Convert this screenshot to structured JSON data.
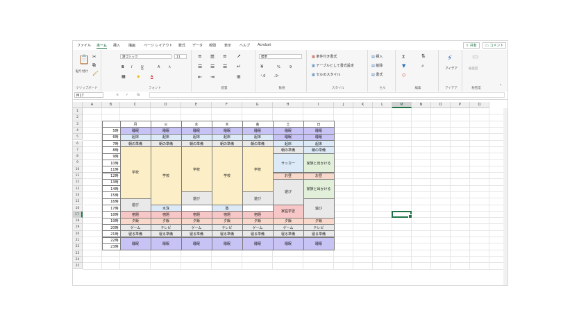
{
  "ribbon": {
    "tabs": [
      "ファイル",
      "ホーム",
      "挿入",
      "描画",
      "ページ レイアウト",
      "数式",
      "データ",
      "校閲",
      "表示",
      "ヘルプ",
      "Acrobat"
    ],
    "active_tab": "ホーム",
    "share_label": "共有",
    "comment_label": "コメント",
    "clipboard": {
      "paste": "貼り付け",
      "label": "クリップボード"
    },
    "font": {
      "name": "游ゴシック",
      "size": "11",
      "bold": "B",
      "italic": "I",
      "underline": "U",
      "grow": "A",
      "shrink": "A",
      "color_a": "A",
      "label": "フォント"
    },
    "alignment": {
      "label": "配置"
    },
    "number": {
      "format": "標準",
      "percent": "%",
      "comma": "9",
      "label": "数値"
    },
    "styles": {
      "conditional": "条件付き書式",
      "table": "テーブルとして書式設定",
      "cell": "セルのスタイル",
      "label": "スタイル"
    },
    "cells": {
      "insert": "挿入",
      "delete": "削除",
      "format": "書式",
      "label": "セル"
    },
    "editing": {
      "sigma": "Σ",
      "label": "編集"
    },
    "ideas": {
      "button": "アイデア",
      "label": "アイデア"
    },
    "sensitivity": {
      "button": "秘密度",
      "label": "秘密度"
    }
  },
  "formula_bar": {
    "name_box": "M17",
    "fx": "fx",
    "cancel": "×",
    "enter": "✓",
    "value": ""
  },
  "columns": [
    "A",
    "B",
    "C",
    "D",
    "E",
    "F",
    "G",
    "H",
    "I",
    "J",
    "K",
    "L",
    "M",
    "N",
    "O",
    "P",
    "Q"
  ],
  "selected_cell": {
    "col": "M",
    "row": "17"
  },
  "rows": [
    "1",
    "2",
    "3",
    "4",
    "5",
    "6",
    "7",
    "8",
    "9",
    "10",
    "11",
    "12",
    "13",
    "14",
    "15",
    "16",
    "17",
    "18",
    "19",
    "20",
    "21",
    "22",
    "23",
    "24",
    "25"
  ],
  "timetable": {
    "days": [
      "月",
      "火",
      "水",
      "木",
      "金",
      "土",
      "日"
    ],
    "hours": [
      "5時",
      "6時",
      "7時",
      "8時",
      "9時",
      "10時",
      "11時",
      "12時",
      "13時",
      "14時",
      "15時",
      "16時",
      "17時",
      "18時",
      "19時",
      "20時",
      "21時",
      "22時",
      "23時"
    ],
    "blocks": [
      {
        "col": 0,
        "r0": 0,
        "r1": 0,
        "text": "睡眠",
        "color": "#c8c3f5"
      },
      {
        "col": 0,
        "r0": 1,
        "r1": 1,
        "text": "起床",
        "color": "#dce9f7"
      },
      {
        "col": 0,
        "r0": 2,
        "r1": 2,
        "text": "朝の準備",
        "color": "#e9e9e9"
      },
      {
        "col": 0,
        "r0": 3,
        "r1": 10,
        "text": "学校",
        "color": "#fcefc7"
      },
      {
        "col": 0,
        "r0": 11,
        "r1": 12,
        "text": "遊び",
        "color": "#e9e9e9"
      },
      {
        "col": 0,
        "r0": 13,
        "r1": 13,
        "text": "宿題",
        "color": "#f7c6c6"
      },
      {
        "col": 0,
        "r0": 14,
        "r1": 14,
        "text": "夕飯",
        "color": "#f9d8cc"
      },
      {
        "col": 0,
        "r0": 15,
        "r1": 15,
        "text": "ゲーム",
        "color": "#e9e9e9"
      },
      {
        "col": 0,
        "r0": 16,
        "r1": 16,
        "text": "寝る準備",
        "color": "#e9e9e9"
      },
      {
        "col": 0,
        "r0": 17,
        "r1": 18,
        "text": "睡眠",
        "color": "#c8c3f5"
      },
      {
        "col": 1,
        "r0": 0,
        "r1": 0,
        "text": "睡眠",
        "color": "#c8c3f5"
      },
      {
        "col": 1,
        "r0": 1,
        "r1": 1,
        "text": "起床",
        "color": "#dce9f7"
      },
      {
        "col": 1,
        "r0": 2,
        "r1": 2,
        "text": "朝の準備",
        "color": "#e9e9e9"
      },
      {
        "col": 1,
        "r0": 3,
        "r1": 11,
        "text": "学校",
        "color": "#fcefc7"
      },
      {
        "col": 1,
        "r0": 12,
        "r1": 12,
        "text": "水泳",
        "color": "#dce9f7"
      },
      {
        "col": 1,
        "r0": 13,
        "r1": 13,
        "text": "宿題",
        "color": "#f7c6c6"
      },
      {
        "col": 1,
        "r0": 14,
        "r1": 14,
        "text": "夕飯",
        "color": "#f9d8cc"
      },
      {
        "col": 1,
        "r0": 15,
        "r1": 15,
        "text": "テレビ",
        "color": "#e9e9e9"
      },
      {
        "col": 1,
        "r0": 16,
        "r1": 16,
        "text": "寝る準備",
        "color": "#e9e9e9"
      },
      {
        "col": 1,
        "r0": 17,
        "r1": 18,
        "text": "睡眠",
        "color": "#c8c3f5"
      },
      {
        "col": 2,
        "r0": 0,
        "r1": 0,
        "text": "睡眠",
        "color": "#c8c3f5"
      },
      {
        "col": 2,
        "r0": 1,
        "r1": 1,
        "text": "起床",
        "color": "#dce9f7"
      },
      {
        "col": 2,
        "r0": 2,
        "r1": 2,
        "text": "朝の準備",
        "color": "#e9e9e9"
      },
      {
        "col": 2,
        "r0": 3,
        "r1": 9,
        "text": "学校",
        "color": "#fcefc7"
      },
      {
        "col": 2,
        "r0": 10,
        "r1": 11,
        "text": "遊び",
        "color": "#e9e9e9"
      },
      {
        "col": 2,
        "r0": 12,
        "r1": 12,
        "text": "",
        "color": "#ffffff"
      },
      {
        "col": 2,
        "r0": 13,
        "r1": 13,
        "text": "宿題",
        "color": "#f7c6c6"
      },
      {
        "col": 2,
        "r0": 14,
        "r1": 14,
        "text": "夕飯",
        "color": "#f9d8cc"
      },
      {
        "col": 2,
        "r0": 15,
        "r1": 15,
        "text": "ゲーム",
        "color": "#e9e9e9"
      },
      {
        "col": 2,
        "r0": 16,
        "r1": 16,
        "text": "寝る準備",
        "color": "#e9e9e9"
      },
      {
        "col": 2,
        "r0": 17,
        "r1": 18,
        "text": "睡眠",
        "color": "#c8c3f5"
      },
      {
        "col": 3,
        "r0": 0,
        "r1": 0,
        "text": "睡眠",
        "color": "#c8c3f5"
      },
      {
        "col": 3,
        "r0": 1,
        "r1": 1,
        "text": "起床",
        "color": "#dce9f7"
      },
      {
        "col": 3,
        "r0": 2,
        "r1": 2,
        "text": "朝の準備",
        "color": "#e9e9e9"
      },
      {
        "col": 3,
        "r0": 3,
        "r1": 11,
        "text": "学校",
        "color": "#fcefc7"
      },
      {
        "col": 3,
        "r0": 12,
        "r1": 12,
        "text": "塾",
        "color": "#dce9f7"
      },
      {
        "col": 3,
        "r0": 13,
        "r1": 13,
        "text": "宿題",
        "color": "#f7c6c6"
      },
      {
        "col": 3,
        "r0": 14,
        "r1": 14,
        "text": "夕飯",
        "color": "#f9d8cc"
      },
      {
        "col": 3,
        "r0": 15,
        "r1": 15,
        "text": "テレビ",
        "color": "#e9e9e9"
      },
      {
        "col": 3,
        "r0": 16,
        "r1": 16,
        "text": "寝る準備",
        "color": "#e9e9e9"
      },
      {
        "col": 3,
        "r0": 17,
        "r1": 18,
        "text": "睡眠",
        "color": "#c8c3f5"
      },
      {
        "col": 4,
        "r0": 0,
        "r1": 0,
        "text": "睡眠",
        "color": "#c8c3f5"
      },
      {
        "col": 4,
        "r0": 1,
        "r1": 1,
        "text": "起床",
        "color": "#dce9f7"
      },
      {
        "col": 4,
        "r0": 2,
        "r1": 2,
        "text": "朝の準備",
        "color": "#e9e9e9"
      },
      {
        "col": 4,
        "r0": 3,
        "r1": 9,
        "text": "学校",
        "color": "#fcefc7"
      },
      {
        "col": 4,
        "r0": 10,
        "r1": 11,
        "text": "遊び",
        "color": "#e9e9e9"
      },
      {
        "col": 4,
        "r0": 12,
        "r1": 12,
        "text": "",
        "color": "#ffffff"
      },
      {
        "col": 4,
        "r0": 13,
        "r1": 13,
        "text": "宿題",
        "color": "#f7c6c6"
      },
      {
        "col": 4,
        "r0": 14,
        "r1": 14,
        "text": "夕飯",
        "color": "#f9d8cc"
      },
      {
        "col": 4,
        "r0": 15,
        "r1": 15,
        "text": "ゲーム",
        "color": "#e9e9e9"
      },
      {
        "col": 4,
        "r0": 16,
        "r1": 16,
        "text": "寝る準備",
        "color": "#e9e9e9"
      },
      {
        "col": 4,
        "r0": 17,
        "r1": 18,
        "text": "睡眠",
        "color": "#c8c3f5"
      },
      {
        "col": 5,
        "r0": 0,
        "r1": 0,
        "text": "睡眠",
        "color": "#c8c3f5"
      },
      {
        "col": 5,
        "r0": 1,
        "r1": 1,
        "text": "睡眠",
        "color": "#c8c3f5"
      },
      {
        "col": 5,
        "r0": 2,
        "r1": 2,
        "text": "起床",
        "color": "#dce9f7"
      },
      {
        "col": 5,
        "r0": 3,
        "r1": 3,
        "text": "朝の準備",
        "color": "#e9e9e9"
      },
      {
        "col": 5,
        "r0": 4,
        "r1": 6,
        "text": "サッカー",
        "color": "#dce9f7"
      },
      {
        "col": 5,
        "r0": 7,
        "r1": 7,
        "text": "お昼",
        "color": "#f9d8cc"
      },
      {
        "col": 5,
        "r0": 8,
        "r1": 11,
        "text": "遊び",
        "color": "#e9e9e9"
      },
      {
        "col": 5,
        "r0": 12,
        "r1": 13,
        "text": "家庭学習",
        "color": "#f7c6c6"
      },
      {
        "col": 5,
        "r0": 14,
        "r1": 14,
        "text": "夕飯",
        "color": "#f9d8cc"
      },
      {
        "col": 5,
        "r0": 15,
        "r1": 15,
        "text": "ゲーム",
        "color": "#e9e9e9"
      },
      {
        "col": 5,
        "r0": 16,
        "r1": 16,
        "text": "寝る準備",
        "color": "#e9e9e9"
      },
      {
        "col": 5,
        "r0": 17,
        "r1": 18,
        "text": "睡眠",
        "color": "#c8c3f5"
      },
      {
        "col": 6,
        "r0": 0,
        "r1": 0,
        "text": "睡眠",
        "color": "#c8c3f5"
      },
      {
        "col": 6,
        "r0": 1,
        "r1": 1,
        "text": "睡眠",
        "color": "#c8c3f5"
      },
      {
        "col": 6,
        "r0": 2,
        "r1": 2,
        "text": "起床",
        "color": "#dce9f7"
      },
      {
        "col": 6,
        "r0": 3,
        "r1": 3,
        "text": "朝の準備",
        "color": "#dce9f7"
      },
      {
        "col": 6,
        "r0": 4,
        "r1": 6,
        "text": "家族と出かける",
        "color": "#e2efd9"
      },
      {
        "col": 6,
        "r0": 7,
        "r1": 7,
        "text": "お昼",
        "color": "#f9d8cc"
      },
      {
        "col": 6,
        "r0": 8,
        "r1": 10,
        "text": "家族と出かける",
        "color": "#e2efd9"
      },
      {
        "col": 6,
        "r0": 11,
        "r1": 13,
        "text": "遊び",
        "color": "#e9e9e9"
      },
      {
        "col": 6,
        "r0": 14,
        "r1": 14,
        "text": "夕飯",
        "color": "#f9d8cc"
      },
      {
        "col": 6,
        "r0": 15,
        "r1": 15,
        "text": "テレビ",
        "color": "#e9e9e9"
      },
      {
        "col": 6,
        "r0": 16,
        "r1": 16,
        "text": "寝る準備",
        "color": "#e9e9e9"
      },
      {
        "col": 6,
        "r0": 17,
        "r1": 18,
        "text": "睡眠",
        "color": "#c8c3f5"
      }
    ]
  }
}
